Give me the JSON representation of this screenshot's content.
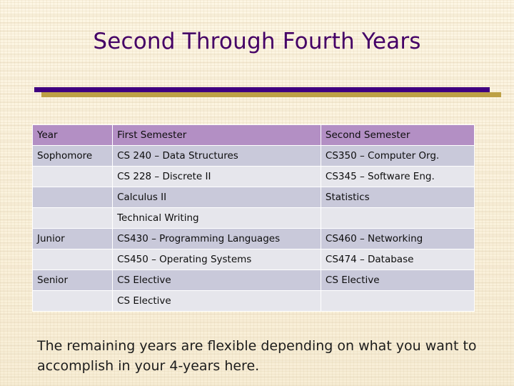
{
  "slide": {
    "title": "Second Through Fourth Years",
    "caption": "The remaining years are flexible depending on what you want to accomplish in your 4-years here.",
    "colors": {
      "title": "#440066",
      "bar_primary": "#3f0080",
      "bar_secondary": "#bda045",
      "header_fill": "#b38fc4",
      "row_dark": "#c9c9da",
      "row_light": "#e6e6ec",
      "background": "#fbf2dc"
    }
  },
  "table": {
    "headers": [
      "Year",
      "First Semester",
      "Second Semester"
    ],
    "rows": [
      {
        "year": "Sophomore",
        "first": "CS 240 – Data Structures",
        "second": "CS350 – Computer Org."
      },
      {
        "year": "",
        "first": "CS 228 – Discrete II",
        "second": "CS345 – Software Eng."
      },
      {
        "year": "",
        "first": "Calculus II",
        "second": "Statistics"
      },
      {
        "year": "",
        "first": "Technical Writing",
        "second": ""
      },
      {
        "year": "Junior",
        "first": "CS430 – Programming Languages",
        "second": "CS460 – Networking"
      },
      {
        "year": "",
        "first": "CS450 – Operating Systems",
        "second": "CS474 – Database"
      },
      {
        "year": "Senior",
        "first": "CS Elective",
        "second": "CS Elective"
      },
      {
        "year": "",
        "first": "CS Elective",
        "second": ""
      }
    ]
  }
}
